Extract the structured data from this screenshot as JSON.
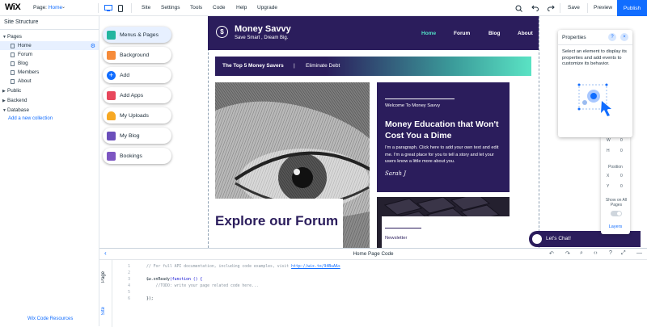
{
  "topbar": {
    "logo": "WiX",
    "page_label": "Page:",
    "page_value": "Home",
    "menu": [
      "Site",
      "Settings",
      "Tools",
      "Code",
      "Help",
      "Upgrade"
    ],
    "save": "Save",
    "preview": "Preview",
    "publish": "Publish"
  },
  "left_panel": {
    "title": "Site Structure",
    "tree": [
      {
        "label": "Pages",
        "type": "folder",
        "open": true
      },
      {
        "label": "Home",
        "type": "page",
        "selected": true
      },
      {
        "label": "Forum",
        "type": "page"
      },
      {
        "label": "Blog",
        "type": "page"
      },
      {
        "label": "Members",
        "type": "page"
      },
      {
        "label": "About",
        "type": "page"
      },
      {
        "label": "Public",
        "type": "folder",
        "open": false
      },
      {
        "label": "Backend",
        "type": "folder",
        "open": false
      },
      {
        "label": "Database",
        "type": "folder",
        "open": true
      }
    ],
    "add_collection": "Add a new collection",
    "code_resources": "Wix Code Resources"
  },
  "add_panel": {
    "items": [
      {
        "label": "Menus & Pages",
        "color": "#23b59f",
        "active": true
      },
      {
        "label": "Background",
        "color": "#f68b3a"
      },
      {
        "label": "Add",
        "color": "#116dff"
      },
      {
        "label": "Add Apps",
        "color": "#e8475c"
      },
      {
        "label": "My Uploads",
        "color": "#f7a823"
      },
      {
        "label": "My Blog",
        "color": "#6b4fbb"
      },
      {
        "label": "Bookings",
        "color": "#7d56c2"
      }
    ]
  },
  "site": {
    "brand": "Money Savvy",
    "tagline": "Save Smart , Dream Big.",
    "nav": [
      "Home",
      "Forum",
      "Blog",
      "About"
    ],
    "nav_active": "Home",
    "banner_left": "The Top 5 Money Savers",
    "banner_sep": "|",
    "banner_right": "Eliminate Debt",
    "welcome": "Welcome To Money Savvy",
    "edu_title": "Money Education that Won't Cost You a Dime",
    "edu_para": "I'm a paragraph. Click here to add your own text and edit me. I'm a great place for you to tell a story and let your users know a little more about you.",
    "signature": "Sarah J",
    "forum_title": "Explore our Forum",
    "newsletter": "Newsletter",
    "chat": "Let's Chat!",
    "coin_symbol": "$",
    "colors": {
      "header": "#2b1d5c",
      "accent": "#52e0c6"
    }
  },
  "properties": {
    "title": "Properties",
    "help": "?",
    "close": "×",
    "hint": "Select an element to display its properties and add events to customize its behavior.",
    "side": {
      "w": "W",
      "h": "H",
      "position": "Position",
      "x": "X",
      "y": "Y",
      "show_all": "Show on All Pages",
      "layers": "Layers"
    }
  },
  "code_panel": {
    "title": "Home Page Code",
    "tabs": [
      "Page",
      "Site"
    ],
    "lines": [
      {
        "n": "1",
        "comment": "// For full API documentation, including code examples, visit ",
        "link": "http://wix.to/94BuAAs"
      },
      {
        "n": "2",
        "text": ""
      },
      {
        "n": "3",
        "kw": "$w.onReady",
        "rest": "(function () {"
      },
      {
        "n": "4",
        "comment": "    //TODO: write your page related code here..."
      },
      {
        "n": "5",
        "text": ""
      },
      {
        "n": "6",
        "text": "});"
      }
    ]
  },
  "accent": "#116dff"
}
